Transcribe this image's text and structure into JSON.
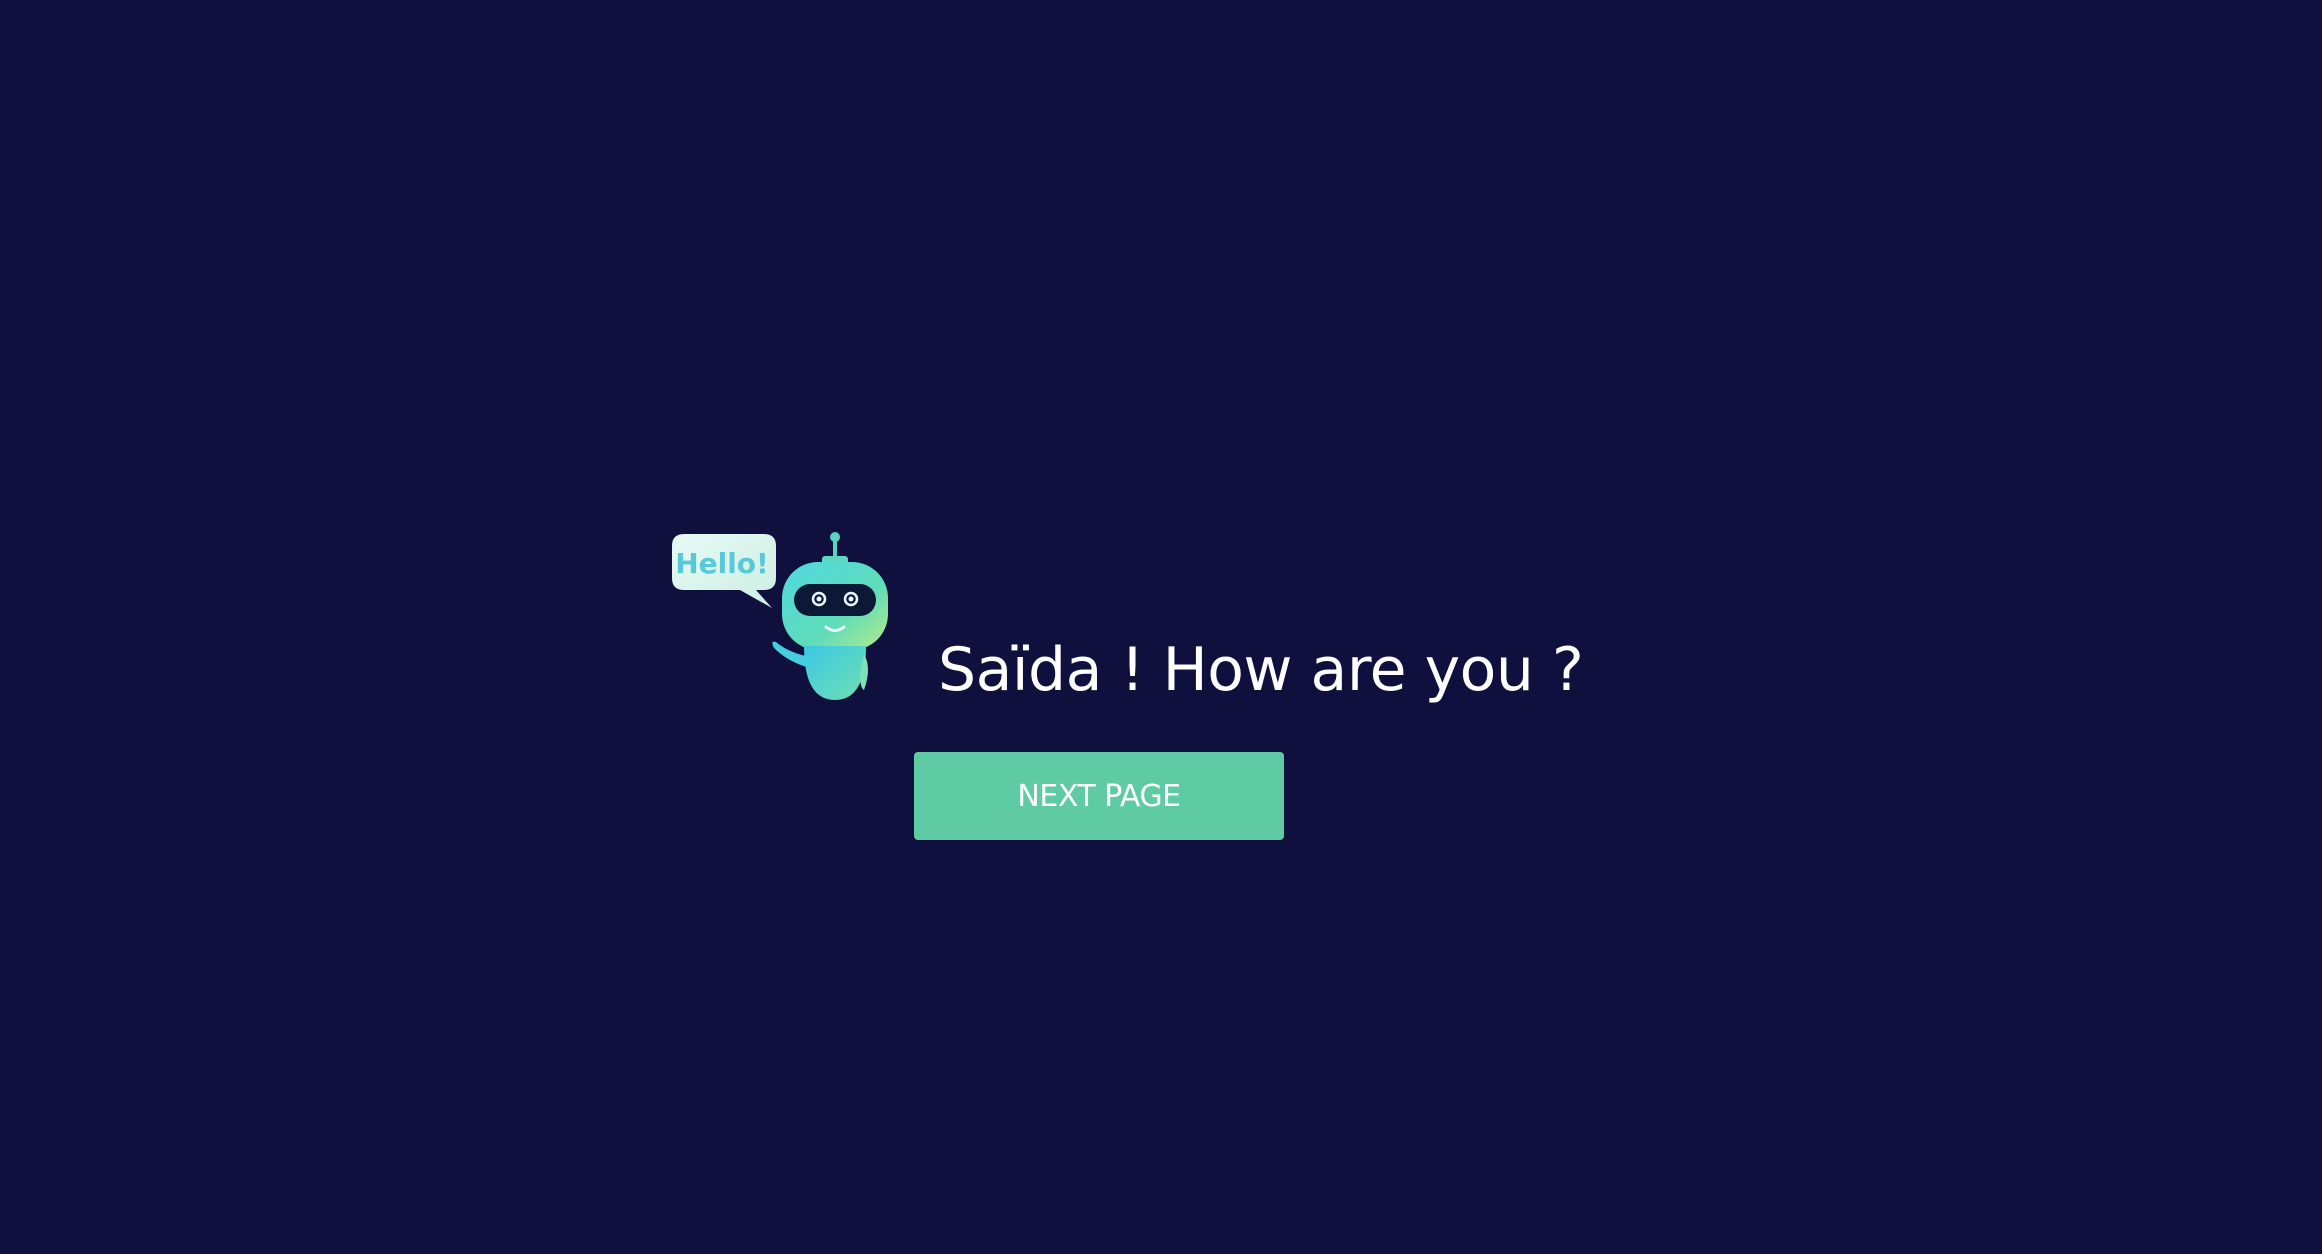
{
  "robot": {
    "bubble_text": "Hello!"
  },
  "main": {
    "greeting": "Saïda ! How are you ?",
    "next_button_label": "NEXT PAGE"
  },
  "colors": {
    "background": "#0f103d",
    "accent": "#5ecba5",
    "text": "#ffffff"
  }
}
